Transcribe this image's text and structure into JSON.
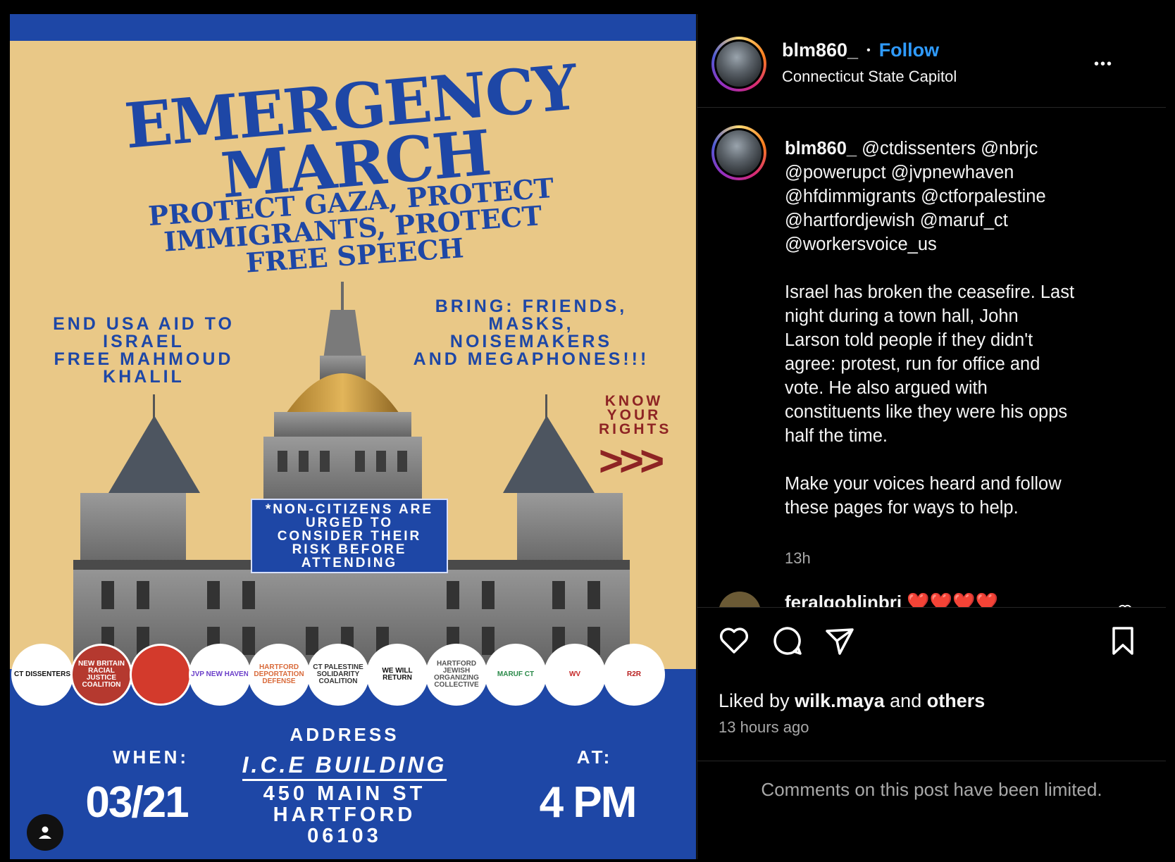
{
  "poster": {
    "headline": "EMERGENCY\nMARCH",
    "subheadline": "PROTECT GAZA, PROTECT IMMIGRANTS, PROTECT FREE SPEECH",
    "left_text": "END USA AID TO\nISRAEL\nFREE MAHMOUD\nKHALIL",
    "right_text": "BRING: FRIENDS,\nMASKS, NOISEMAKERS\nAND MEGAPHONES!!!",
    "know_rights": "KNOW\nYOUR\nRIGHTS",
    "arrows": ">>>",
    "notice": "*NON-CITIZENS ARE URGED TO CONSIDER THEIR RISK BEFORE ATTENDING",
    "logos": [
      {
        "label": "CT DISSENTERS",
        "bg": "#ffffff",
        "fg": "#111111"
      },
      {
        "label": "NEW BRITAIN RACIAL JUSTICE COALITION",
        "bg": "#b5392f",
        "fg": "#ffffff"
      },
      {
        "label": "",
        "bg": "#d33a2c",
        "fg": "#ffffff"
      },
      {
        "label": "JVP NEW HAVEN",
        "bg": "#ffffff",
        "fg": "#6a3ec9"
      },
      {
        "label": "HARTFORD DEPORTATION DEFENSE",
        "bg": "#ffffff",
        "fg": "#d96a3a"
      },
      {
        "label": "CT PALESTINE SOLIDARITY COALITION",
        "bg": "#ffffff",
        "fg": "#333333"
      },
      {
        "label": "WE WILL RETURN",
        "bg": "#ffffff",
        "fg": "#111111"
      },
      {
        "label": "HARTFORD JEWISH ORGANIZING COLLECTIVE",
        "bg": "#ffffff",
        "fg": "#555555"
      },
      {
        "label": "MARUF CT",
        "bg": "#ffffff",
        "fg": "#2b8a4a"
      },
      {
        "label": "WV",
        "bg": "#ffffff",
        "fg": "#c62828"
      },
      {
        "label": "R2R",
        "bg": "#ffffff",
        "fg": "#b71c1c"
      }
    ],
    "when_label": "WHEN:",
    "date": "03/21",
    "address_label": "ADDRESS",
    "address_place": "I.C.E BUILDING",
    "address_lines": "450 MAIN ST\nHARTFORD\n06103",
    "at_label": "AT:",
    "time": "4 PM"
  },
  "header": {
    "username": "blm860_",
    "dot": "•",
    "follow_label": "Follow",
    "location": "Connecticut State Capitol",
    "more": "•••"
  },
  "caption": {
    "username": "blm860_",
    "mentions": " @ctdissenters @nbrjc\n@powerupct @jvpnewhaven\n@hfdimmigrants @ctforpalestine\n@hartfordjewish @maruf_ct\n@workersvoice_us",
    "body": "Israel has broken the ceasefire. Last\nnight during a town hall, John\nLarson told people if they didn't\nagree: protest, run for office and\nvote. He also argued with\nconstituents like they were his opps\nhalf the time.\n\nMake your voices heard and follow\nthese pages for ways to help.",
    "time": "13h"
  },
  "comment": {
    "username": "feralgoblinbri",
    "text": "❤️❤️❤️❤️"
  },
  "likes": {
    "prefix": "Liked by ",
    "user": "wilk.maya",
    "and": " and ",
    "others": "others",
    "ago": "13 hours ago"
  },
  "comments_limited": "Comments on this post have been limited.",
  "colors": {
    "accent": "#2f9bff",
    "poster_blue": "#1e47a6",
    "poster_tan": "#e9c887",
    "poster_red": "#8e2424"
  }
}
